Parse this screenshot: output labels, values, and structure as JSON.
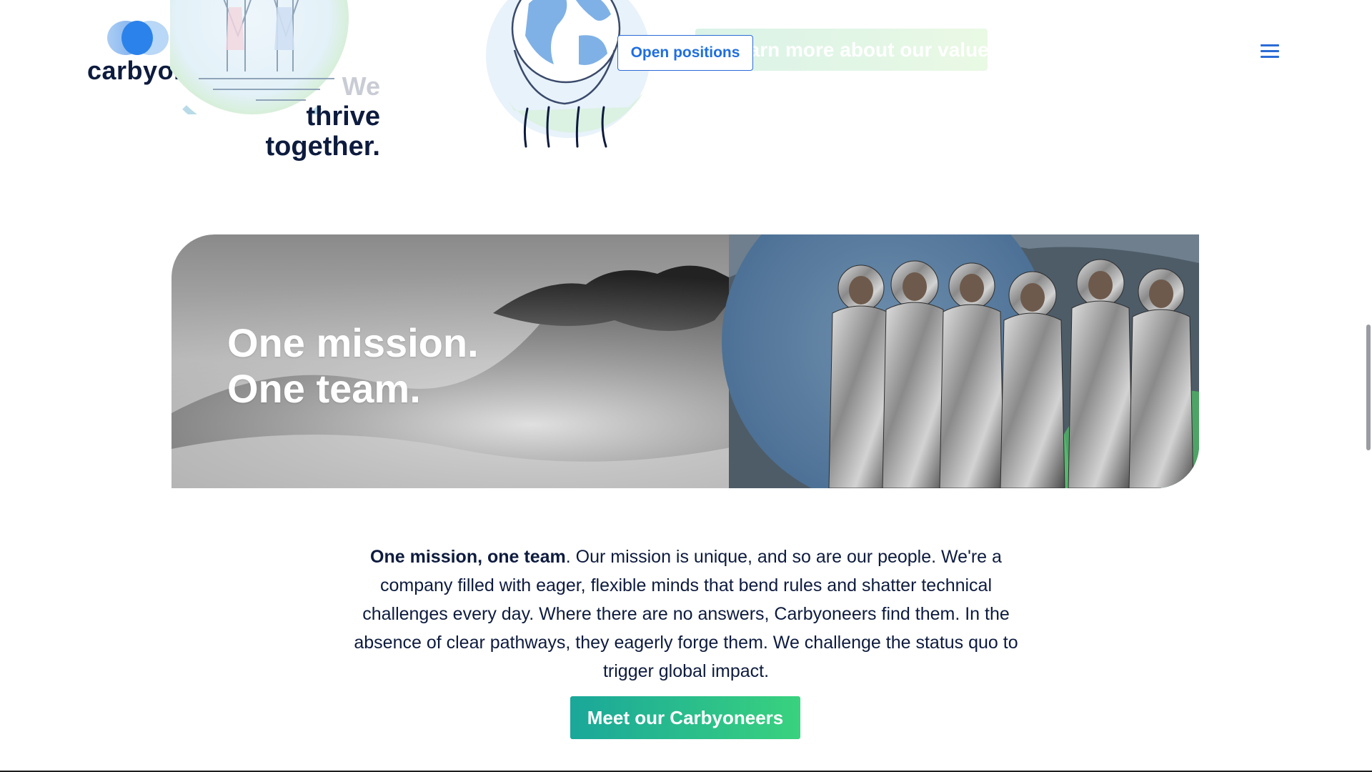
{
  "header": {
    "logo_text": "carbyon",
    "menu_icon": "hamburger-menu-icon"
  },
  "values_section": {
    "tagline_faded": "We",
    "tagline_line1": "thrive",
    "tagline_line2": "together.",
    "values_button_label": "Learn more about our values",
    "open_positions_label": "Open positions"
  },
  "hero": {
    "title_line1": "One mission.",
    "title_line2": "One team."
  },
  "body": {
    "lead_bold": "One mission, one team",
    "paragraph_rest": ". Our mission is unique, and so are our people. We're a company filled with eager, flexible minds that bend rules and shatter technical challenges every day. Where there are no answers, Carbyoneers find them. In the absence of clear pathways, they eagerly forge them. We challenge the status quo to trigger global impact."
  },
  "cta": {
    "label": "Meet our Carbyoneers"
  },
  "colors": {
    "brand_navy": "#0d1b3e",
    "brand_blue": "#2c6bd6",
    "cta_gradient_start": "#1aa79a",
    "cta_gradient_end": "#39d27e"
  }
}
